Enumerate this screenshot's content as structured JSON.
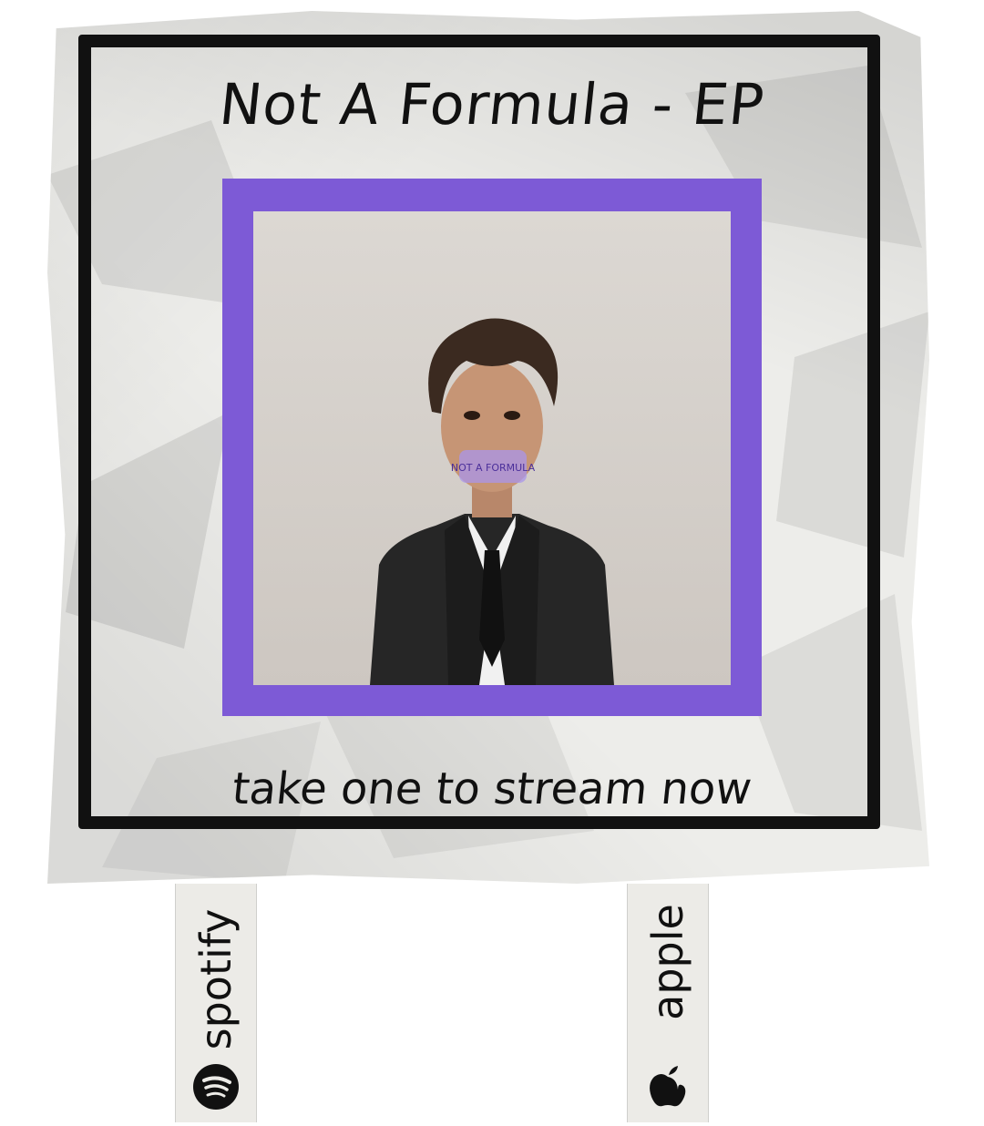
{
  "flyer": {
    "title": "Not A Formula - EP",
    "caption": "take one to stream now",
    "cover_text": "NOT A FORMULA",
    "accent_color": "#7d5ad6"
  },
  "tabs": [
    {
      "label": "spotify",
      "icon": "spotify-icon"
    },
    {
      "label": "apple",
      "icon": "apple-icon"
    }
  ]
}
